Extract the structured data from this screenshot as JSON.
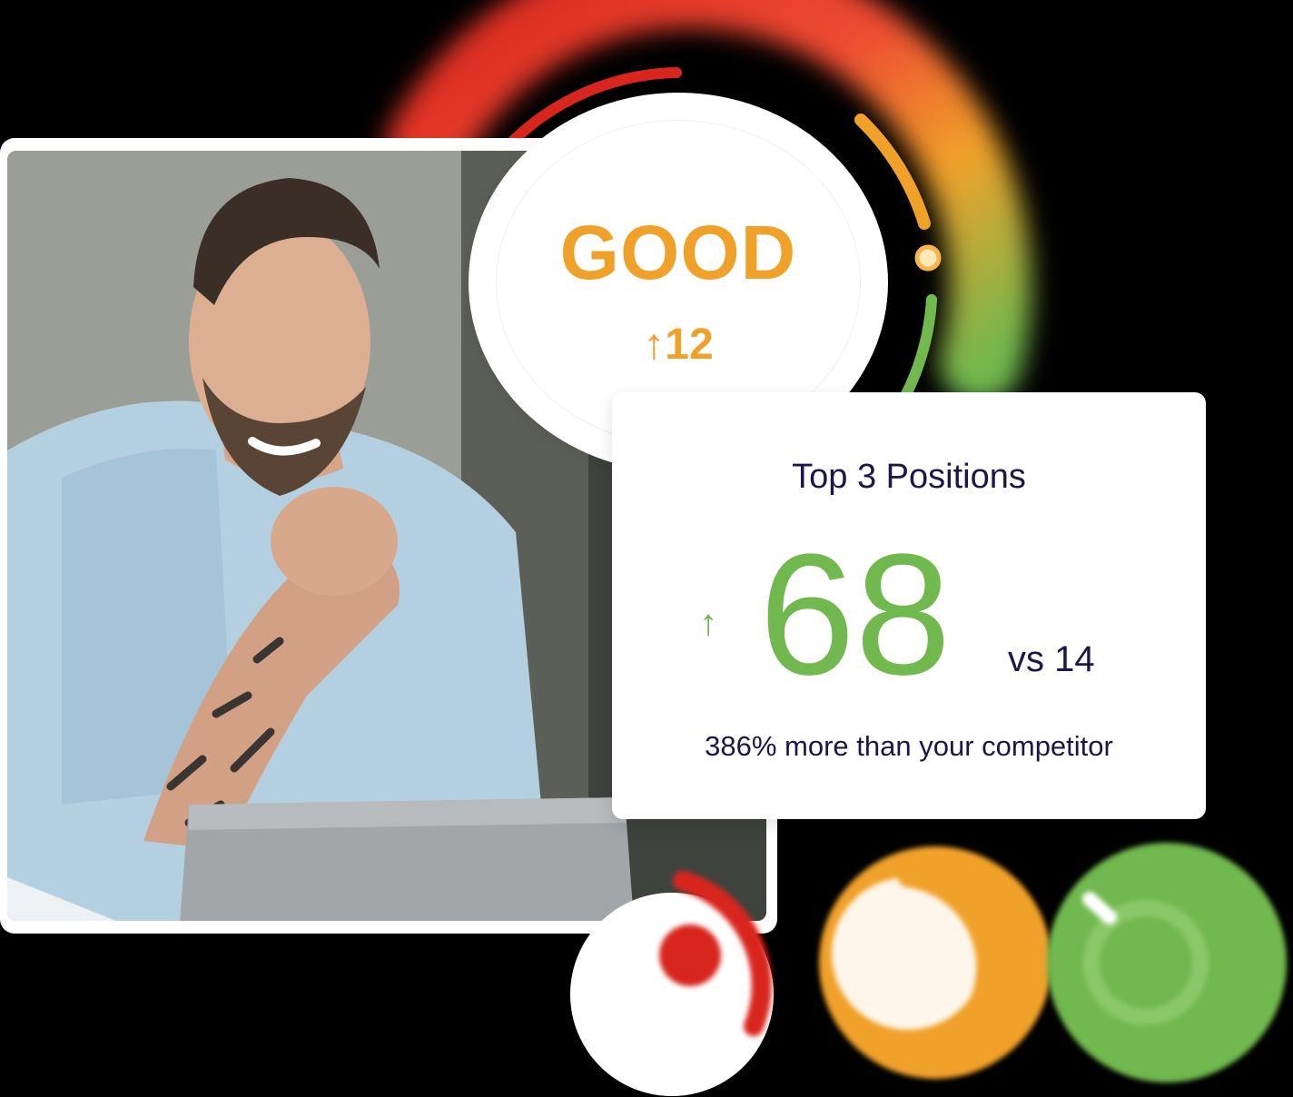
{
  "photo": {
    "subject": "smiling man with a tattooed forearm using a laptop"
  },
  "score_badge": {
    "rating": "GOOD",
    "delta": "↑12",
    "color": "#f0a12a"
  },
  "gauge": {
    "colors": [
      "#d8261f",
      "#f0a12a",
      "#71b84e"
    ],
    "level": 0.75
  },
  "stats_card": {
    "title": "Top 3 Positions",
    "arrow": "↑",
    "value": "68",
    "comparison": "vs 14",
    "note": "386% more than your competitor",
    "value_color": "#71b84e"
  },
  "status_indicators": [
    {
      "color": "#d8261f",
      "icon": "ring-icon"
    },
    {
      "color": "#f0a12a",
      "icon": "ring-icon"
    },
    {
      "color": "#71b84e",
      "icon": "ring-icon"
    }
  ]
}
